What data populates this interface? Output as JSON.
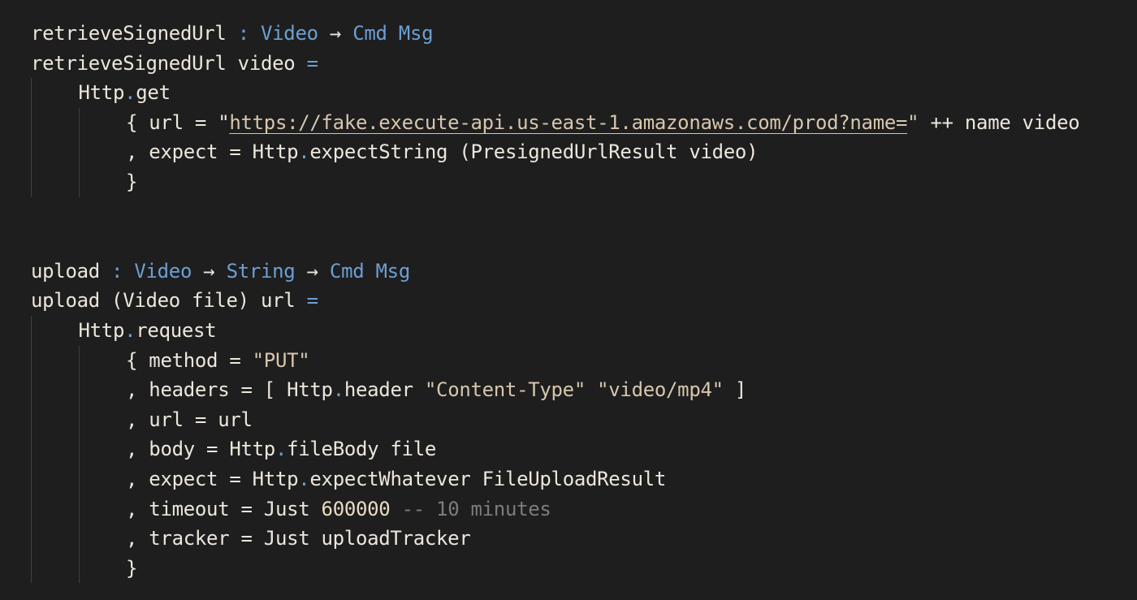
{
  "colors": {
    "background": "#1e1e1e",
    "text": "#ece6dc",
    "keyword": "#6d9fd2",
    "string": "#d7c6ae",
    "comment": "#7c7c7c"
  },
  "lines": [
    {
      "indent": 0,
      "tokens": [
        {
          "t": "retrieveSignedUrl",
          "c": "p"
        },
        {
          "t": " : ",
          "c": "k"
        },
        {
          "t": "Video",
          "c": "k"
        },
        {
          "t": " → ",
          "c": "p"
        },
        {
          "t": "Cmd Msg",
          "c": "k"
        }
      ]
    },
    {
      "indent": 0,
      "tokens": [
        {
          "t": "retrieveSignedUrl video ",
          "c": "p"
        },
        {
          "t": "=",
          "c": "k"
        }
      ]
    },
    {
      "indent": 1,
      "tokens": [
        {
          "t": "Http",
          "c": "p"
        },
        {
          "t": ".",
          "c": "k"
        },
        {
          "t": "get",
          "c": "p"
        }
      ]
    },
    {
      "indent": 2,
      "tokens": [
        {
          "t": "{ url = \"",
          "c": "p"
        },
        {
          "t": "https://fake.execute-api.us-east-1.amazonaws.com/prod?name=",
          "c": "u"
        },
        {
          "t": "\"",
          "c": "s"
        },
        {
          "t": " ++ name video",
          "c": "p"
        }
      ]
    },
    {
      "indent": 2,
      "tokens": [
        {
          "t": ", expect = Http",
          "c": "p"
        },
        {
          "t": ".",
          "c": "k"
        },
        {
          "t": "expectString (PresignedUrlResult video)",
          "c": "p"
        }
      ]
    },
    {
      "indent": 2,
      "tokens": [
        {
          "t": "}",
          "c": "p"
        }
      ]
    },
    {
      "indent": 0,
      "tokens": []
    },
    {
      "indent": 0,
      "tokens": []
    },
    {
      "indent": 0,
      "tokens": [
        {
          "t": "upload",
          "c": "p"
        },
        {
          "t": " : ",
          "c": "k"
        },
        {
          "t": "Video",
          "c": "k"
        },
        {
          "t": " → ",
          "c": "p"
        },
        {
          "t": "String",
          "c": "k"
        },
        {
          "t": " → ",
          "c": "p"
        },
        {
          "t": "Cmd Msg",
          "c": "k"
        }
      ]
    },
    {
      "indent": 0,
      "tokens": [
        {
          "t": "upload (Video file) url ",
          "c": "p"
        },
        {
          "t": "=",
          "c": "k"
        }
      ]
    },
    {
      "indent": 1,
      "tokens": [
        {
          "t": "Http",
          "c": "p"
        },
        {
          "t": ".",
          "c": "k"
        },
        {
          "t": "request",
          "c": "p"
        }
      ]
    },
    {
      "indent": 2,
      "tokens": [
        {
          "t": "{ method = ",
          "c": "p"
        },
        {
          "t": "\"PUT\"",
          "c": "s"
        }
      ]
    },
    {
      "indent": 2,
      "tokens": [
        {
          "t": ", headers = [ Http",
          "c": "p"
        },
        {
          "t": ".",
          "c": "k"
        },
        {
          "t": "header ",
          "c": "p"
        },
        {
          "t": "\"Content-Type\" \"video/mp4\"",
          "c": "s"
        },
        {
          "t": " ]",
          "c": "p"
        }
      ]
    },
    {
      "indent": 2,
      "tokens": [
        {
          "t": ", url = url",
          "c": "p"
        }
      ]
    },
    {
      "indent": 2,
      "tokens": [
        {
          "t": ", body = Http",
          "c": "p"
        },
        {
          "t": ".",
          "c": "k"
        },
        {
          "t": "fileBody file",
          "c": "p"
        }
      ]
    },
    {
      "indent": 2,
      "tokens": [
        {
          "t": ", expect = Http",
          "c": "p"
        },
        {
          "t": ".",
          "c": "k"
        },
        {
          "t": "expectWhatever FileUploadResult",
          "c": "p"
        }
      ]
    },
    {
      "indent": 2,
      "tokens": [
        {
          "t": ", timeout = Just ",
          "c": "p"
        },
        {
          "t": "600000",
          "c": "n"
        },
        {
          "t": " -- 10 minutes",
          "c": "c"
        }
      ]
    },
    {
      "indent": 2,
      "tokens": [
        {
          "t": ", tracker = Just uploadTracker",
          "c": "p"
        }
      ]
    },
    {
      "indent": 2,
      "tokens": [
        {
          "t": "}",
          "c": "p"
        }
      ]
    }
  ]
}
